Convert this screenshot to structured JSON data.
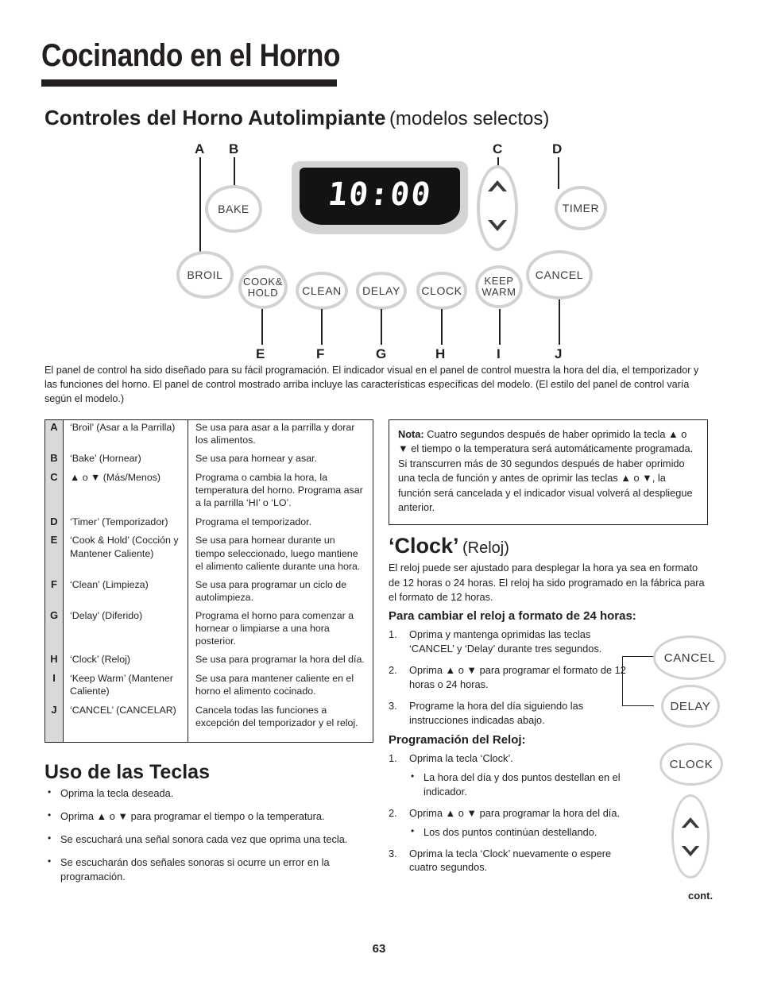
{
  "page": {
    "title": "Cocinando en el Horno",
    "number": "63",
    "continued_label": "cont."
  },
  "section": {
    "heading_main": "Controles del Horno Autolimpiante",
    "heading_sub": "(modelos selectos)"
  },
  "panel": {
    "display_value": "10:00",
    "buttons": [
      {
        "id": "bake",
        "label": "BAKE"
      },
      {
        "id": "broil",
        "label": "BROIL"
      },
      {
        "id": "cook-hold",
        "label": "COOK&\nHOLD",
        "line1": "COOK&",
        "line2": "HOLD"
      },
      {
        "id": "clean",
        "label": "CLEAN"
      },
      {
        "id": "delay",
        "label": "DELAY"
      },
      {
        "id": "clock",
        "label": "CLOCK"
      },
      {
        "id": "keep-warm",
        "label": "KEEP\nWARM",
        "line1": "KEEP",
        "line2": "WARM"
      },
      {
        "id": "cancel",
        "label": "CANCEL"
      },
      {
        "id": "timer",
        "label": "TIMER"
      },
      {
        "id": "updown",
        "label": ""
      }
    ],
    "ref_letters": {
      "a": "A",
      "b": "B",
      "c": "C",
      "d": "D",
      "e": "E",
      "f": "F",
      "g": "G",
      "h": "H",
      "i": "I",
      "j": "J"
    }
  },
  "intro_paragraph": "El panel de control ha sido diseñado para su fácil programación. El indicador visual en el panel de control muestra la hora del día, el temporizador y las funciones del horno. El panel de control mostrado arriba incluye las características específicas del modelo.  (El estilo del panel de control varía según el modelo.)",
  "legend": {
    "rows": [
      {
        "key": "A",
        "name": "‘Broil’ (Asar a la Parrilla)",
        "desc": "Se usa para asar a la parrilla y dorar los alimentos."
      },
      {
        "key": "B",
        "name": "‘Bake’ (Hornear)",
        "desc": "Se usa para hornear y asar."
      },
      {
        "key": "C",
        "name": "▲ o ▼ (Más/Menos)",
        "desc": "Programa o cambia la hora, la temperatura del horno. Programa asar a la parrilla ‘HI’ o ‘LO’."
      },
      {
        "key": "D",
        "name": "‘Timer’  (Temporizador)",
        "desc": "Programa el temporizador."
      },
      {
        "key": "E",
        "name": "‘Cook & Hold’ (Cocción y Mantener Caliente)",
        "desc": "Se usa para hornear durante un tiempo seleccionado, luego mantiene el alimento caliente durante una hora."
      },
      {
        "key": "F",
        "name": "‘Clean’ (Limpieza)",
        "desc": "Se usa para programar un ciclo de autolimpieza."
      },
      {
        "key": "G",
        "name": "‘Delay’  (Diferido)",
        "desc": "Programa el horno para comenzar a hornear o limpiarse a una hora posterior."
      },
      {
        "key": "H",
        "name": "‘Clock’ (Reloj)",
        "desc": "Se usa para programar la hora del día."
      },
      {
        "key": "I",
        "name": "‘Keep Warm’ (Mantener Caliente)",
        "desc": "Se usa para mantener caliente en el horno el alimento cocinado."
      },
      {
        "key": "J",
        "name": "‘CANCEL’ (CANCELAR)",
        "desc": "Cancela todas las funciones a excepción del temporizador y el reloj."
      }
    ]
  },
  "nota": {
    "label": "Nota:",
    "text": "Cuatro segundos después de haber oprimido la tecla ▲ o ▼ el tiempo o la temperatura será automáticamente programada. Si transcurren más de 30 segundos después de haber oprimido una tecla de función y antes de oprimir las teclas ▲ o ▼, la función será cancelada y el indicador visual volverá al despliegue anterior."
  },
  "clock_section": {
    "heading_big": "‘Clock’",
    "heading_paren": "(Reloj)",
    "paragraph": "El reloj puede ser ajustado para desplegar la hora ya sea en formato de 12 horas o 24 horas. El reloj ha sido programado en la fábrica para el formato de 12 horas.",
    "subheading_24h": "Para cambiar el reloj a formato de 24 horas:",
    "steps_24h": [
      {
        "num": "1.",
        "text": "Oprima y mantenga oprimidas las teclas ‘CANCEL’ y ‘Delay’ durante tres segundos."
      },
      {
        "num": "2.",
        "text": "Oprima ▲ o ▼ para programar el formato de 12 horas o 24 horas."
      },
      {
        "num": "3.",
        "text": "Programe la hora del día siguiendo las instrucciones indicadas abajo."
      }
    ],
    "subheading_prog": "Programación del Reloj:",
    "steps_prog": [
      {
        "num": "1.",
        "text": "Oprima la tecla ‘Clock’.",
        "sub": [
          "La hora del día y dos puntos destellan en el indicador."
        ]
      },
      {
        "num": "2.",
        "text": "Oprima ▲ o ▼ para programar la hora del día.",
        "sub": [
          "Los dos puntos continúan destellando."
        ]
      },
      {
        "num": "3.",
        "text": "Oprima la tecla ‘Clock’ nuevamente o espere cuatro segundos.",
        "sub": []
      }
    ],
    "side_buttons": [
      {
        "id": "cancel",
        "label": "CANCEL"
      },
      {
        "id": "delay",
        "label": "DELAY"
      },
      {
        "id": "clock",
        "label": "CLOCK"
      },
      {
        "id": "updown",
        "label": ""
      }
    ]
  },
  "uso_section": {
    "heading": "Uso de las Teclas",
    "bullets": [
      "Oprima la tecla deseada.",
      "Oprima ▲ o ▼ para programar el tiempo o la temperatura.",
      "Se escuchará una señal sonora cada vez que oprima una tecla.",
      "Se escucharán dos señales sonoras si ocurre un error en la programación."
    ]
  },
  "colors": {
    "ink": "#231f20",
    "button_outline": "#d2d2d2",
    "key_cell_bg": "#d9d9d9",
    "display_bg": "#131313",
    "bezel": "#d4d4d4"
  }
}
